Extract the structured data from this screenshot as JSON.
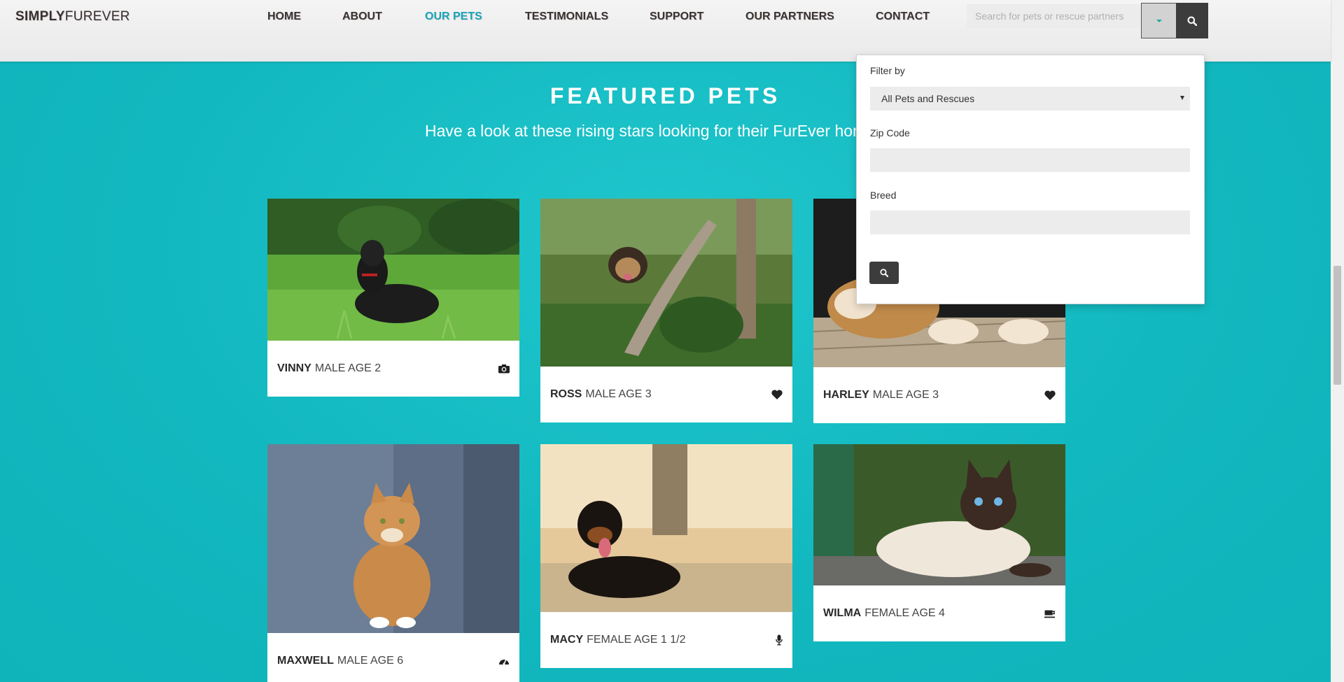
{
  "brand": {
    "bold": "SIMPLY",
    "regular": "FUREVER"
  },
  "nav": {
    "items": [
      {
        "label": "HOME"
      },
      {
        "label": "ABOUT"
      },
      {
        "label": "OUR PETS",
        "active": true
      },
      {
        "label": "TESTIMONIALS"
      },
      {
        "label": "SUPPORT"
      },
      {
        "label": "OUR PARTNERS"
      },
      {
        "label": "CONTACT"
      }
    ],
    "search_placeholder": "Search for pets or rescue partners",
    "search_value": ""
  },
  "filter": {
    "filter_by_label": "Filter by",
    "filter_by_value": "All Pets and Rescues",
    "zip_label": "Zip Code",
    "zip_value": "",
    "breed_label": "Breed",
    "breed_value": ""
  },
  "section": {
    "title": "FEATURED PETS",
    "subtitle": "Have a look at these rising stars looking for their FurEver home."
  },
  "pets": [
    {
      "name": "VINNY",
      "desc": "MALE AGE 2",
      "icon": "camera-icon"
    },
    {
      "name": "ROSS",
      "desc": "MALE AGE 3",
      "icon": "heart-icon"
    },
    {
      "name": "HARLEY",
      "desc": "MALE AGE 3",
      "icon": "heart-icon"
    },
    {
      "name": "MAXWELL",
      "desc": "MALE AGE 6",
      "icon": "dashboard-icon"
    },
    {
      "name": "MACY",
      "desc": "FEMALE AGE 1 1/2",
      "icon": "microphone-icon"
    },
    {
      "name": "WILMA",
      "desc": "FEMALE AGE 4",
      "icon": "coffee-cup-icon"
    }
  ],
  "colors": {
    "accent": "#1aa3b9",
    "section_bg": "#12b8bf",
    "dark_button": "#3c3c3c"
  }
}
